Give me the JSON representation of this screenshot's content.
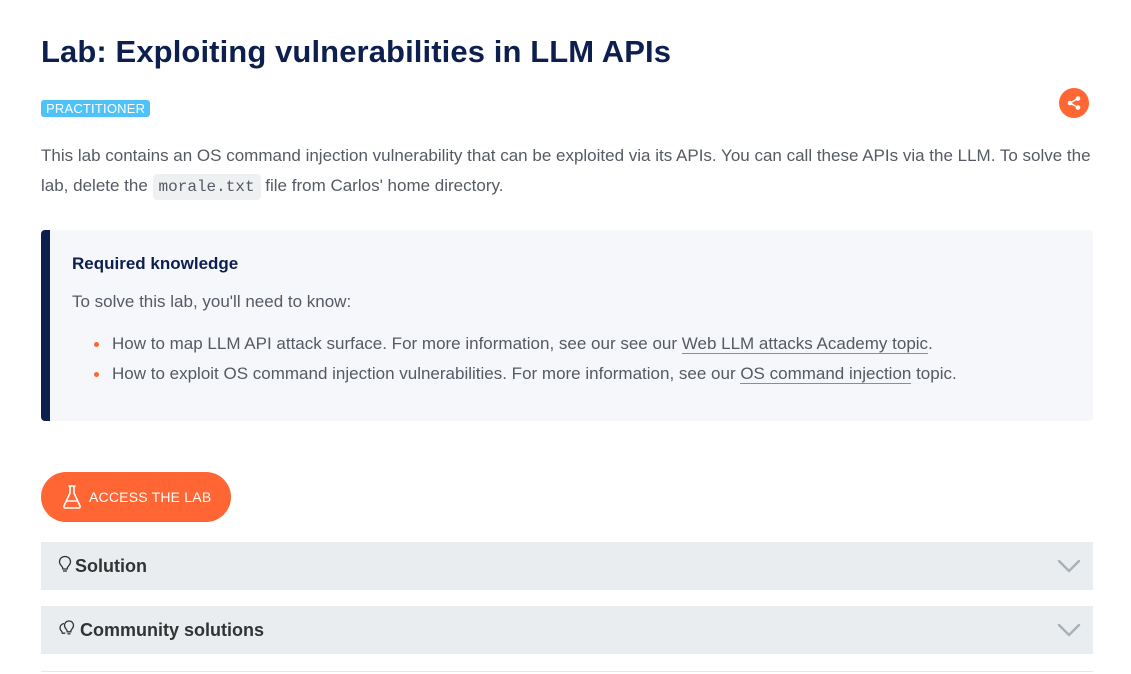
{
  "header": {
    "title": "Lab: Exploiting vulnerabilities in LLM APIs",
    "level_badge": "PRACTITIONER"
  },
  "intro": {
    "text_before": "This lab contains an OS command injection vulnerability that can be exploited via its APIs. You can call these APIs via the LLM. To solve the lab, delete the ",
    "code": "morale.txt",
    "text_after": " file from Carlos' home directory."
  },
  "knowledge": {
    "title": "Required knowledge",
    "intro": "To solve this lab, you'll need to know:",
    "items": [
      {
        "before": "How to map LLM API attack surface. For more information, see our see our ",
        "link": "Web LLM attacks Academy topic",
        "after": "."
      },
      {
        "before": "How to exploit OS command injection vulnerabilities. For more information, see our ",
        "link": "OS command injection",
        "after": " topic."
      }
    ]
  },
  "access_button": {
    "label": "ACCESS THE LAB",
    "icon": "flask-icon"
  },
  "accordions": [
    {
      "label": "Solution",
      "icon": "lightbulb-icon"
    },
    {
      "label": "Community solutions",
      "icon": "lightbulbs-icon"
    }
  ],
  "share": {
    "icon": "share-icon"
  },
  "colors": {
    "accent": "#ff6633",
    "navy": "#0c1f4e",
    "badge": "#4fc3f7",
    "panel": "#f6f7fa",
    "accordion": "#e9edf0",
    "body_text": "#555a63"
  }
}
